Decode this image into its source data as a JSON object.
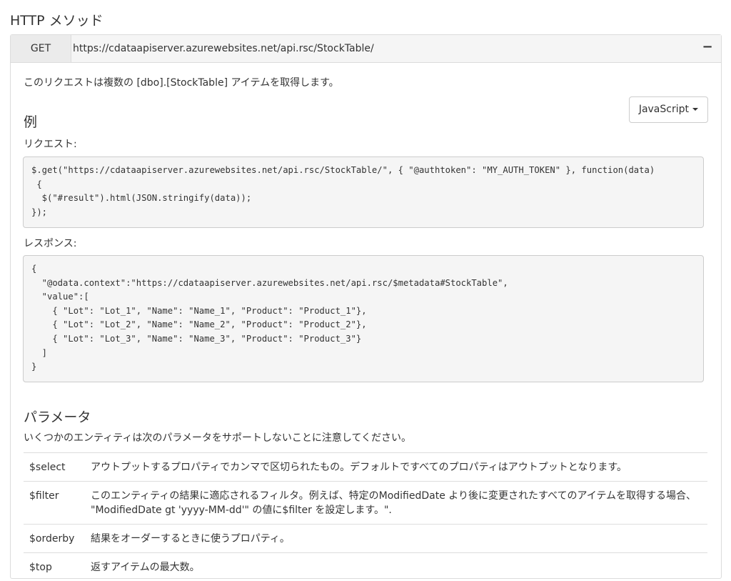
{
  "section_title": "HTTP メソッド",
  "panel": {
    "method": "GET",
    "endpoint": "https://cdataapiserver.azurewebsites.net/api.rsc/StockTable/",
    "collapse_symbol": "−"
  },
  "description": "このリクエストは複数の [dbo].[StockTable] アイテムを取得します。",
  "example": {
    "title": "例",
    "language_button": "JavaScript",
    "request_label": "リクエスト:",
    "request_code": "$.get(\"https://cdataapiserver.azurewebsites.net/api.rsc/StockTable/\", { \"@authtoken\": \"MY_AUTH_TOKEN\" }, function(data)\n {\n  $(\"#result\").html(JSON.stringify(data));\n});",
    "response_label": "レスポンス:",
    "response_code": "{\n  \"@odata.context\":\"https://cdataapiserver.azurewebsites.net/api.rsc/$metadata#StockTable\",\n  \"value\":[\n    { \"Lot\": \"Lot_1\", \"Name\": \"Name_1\", \"Product\": \"Product_1\"},\n    { \"Lot\": \"Lot_2\", \"Name\": \"Name_2\", \"Product\": \"Product_2\"},\n    { \"Lot\": \"Lot_3\", \"Name\": \"Name_3\", \"Product\": \"Product_3\"}\n  ]\n}"
  },
  "parameters": {
    "title": "パラメータ",
    "note": "いくつかのエンティティは次のパラメータをサポートしないことに注意してください。",
    "rows": [
      {
        "name": "$select",
        "desc": "アウトプットするプロパティでカンマで区切られたもの。デフォルトですべてのプロパティはアウトプットとなります。"
      },
      {
        "name": "$filter",
        "desc": "このエンティティの結果に適応されるフィルタ。例えば、特定のModifiedDate より後に変更されたすべてのアイテムを取得する場合、 \"ModifiedDate gt 'yyyy-MM-dd'\" の値に$filter を設定します。\"."
      },
      {
        "name": "$orderby",
        "desc": "結果をオーダーするときに使うプロパティ。"
      },
      {
        "name": "$top",
        "desc": "返すアイテムの最大数。"
      }
    ]
  }
}
